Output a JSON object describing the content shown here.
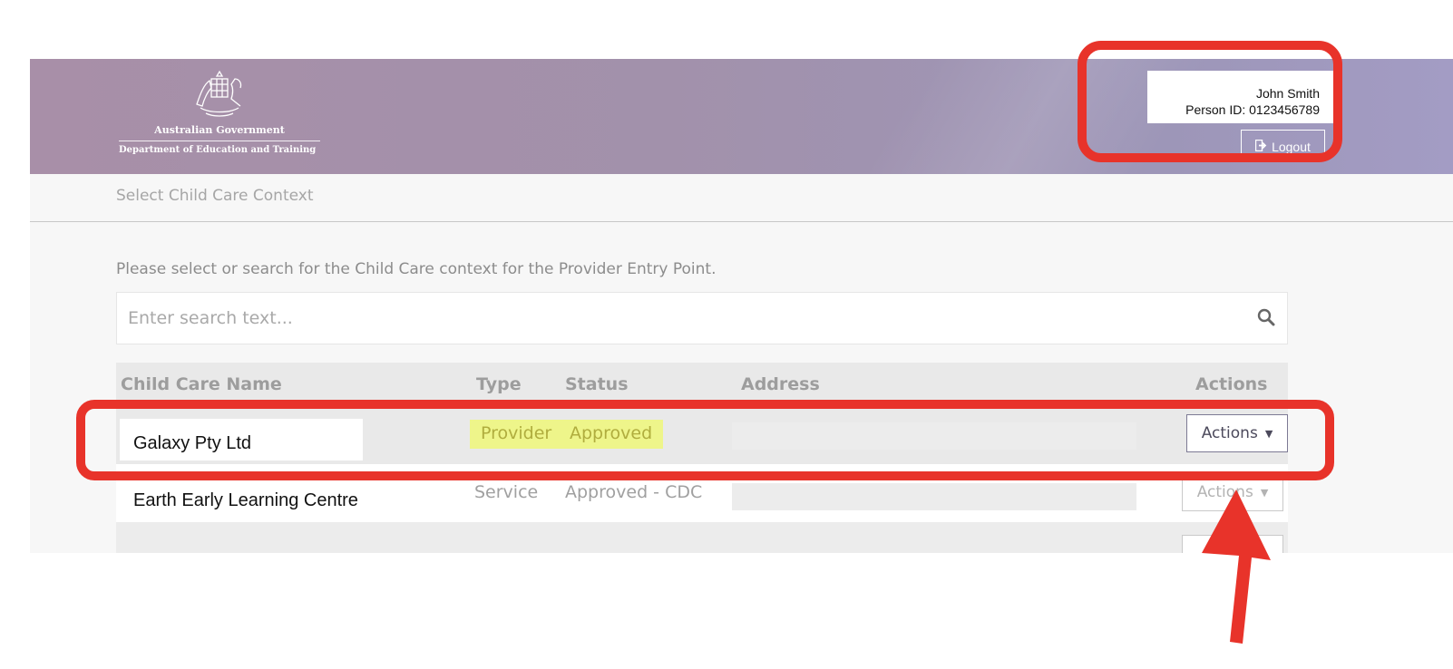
{
  "header": {
    "gov_name": "Australian Government",
    "department": "Department of Education and Training",
    "user": {
      "name": "John Smith",
      "person_id": "Person ID: 0123456789"
    },
    "logout_label": "Logout"
  },
  "subbar": {
    "title": "Select Child Care Context"
  },
  "main": {
    "intro": "Please select or search for the Child Care context for the Provider Entry Point.",
    "search_placeholder": "Enter search text..."
  },
  "table": {
    "columns": [
      "Child Care Name",
      "Type",
      "Status",
      "Address",
      "Actions"
    ],
    "rows": [
      {
        "name": "Galaxy Pty Ltd",
        "type": "Provider",
        "status": "Approved",
        "address": "",
        "action": "Actions"
      },
      {
        "name": "Earth Early Learning Centre",
        "type": "Service",
        "status": "Approved - CDC",
        "address": "",
        "action": "Actions"
      }
    ]
  },
  "colors": {
    "header_gradient_start": "#a88fa8",
    "header_gradient_end": "#a39cc4",
    "annotation_red": "#e8332a",
    "highlight_yellow": "#eef58a"
  },
  "icons": [
    "coat-of-arms-icon",
    "logout-icon",
    "search-icon",
    "caret-down-icon"
  ]
}
